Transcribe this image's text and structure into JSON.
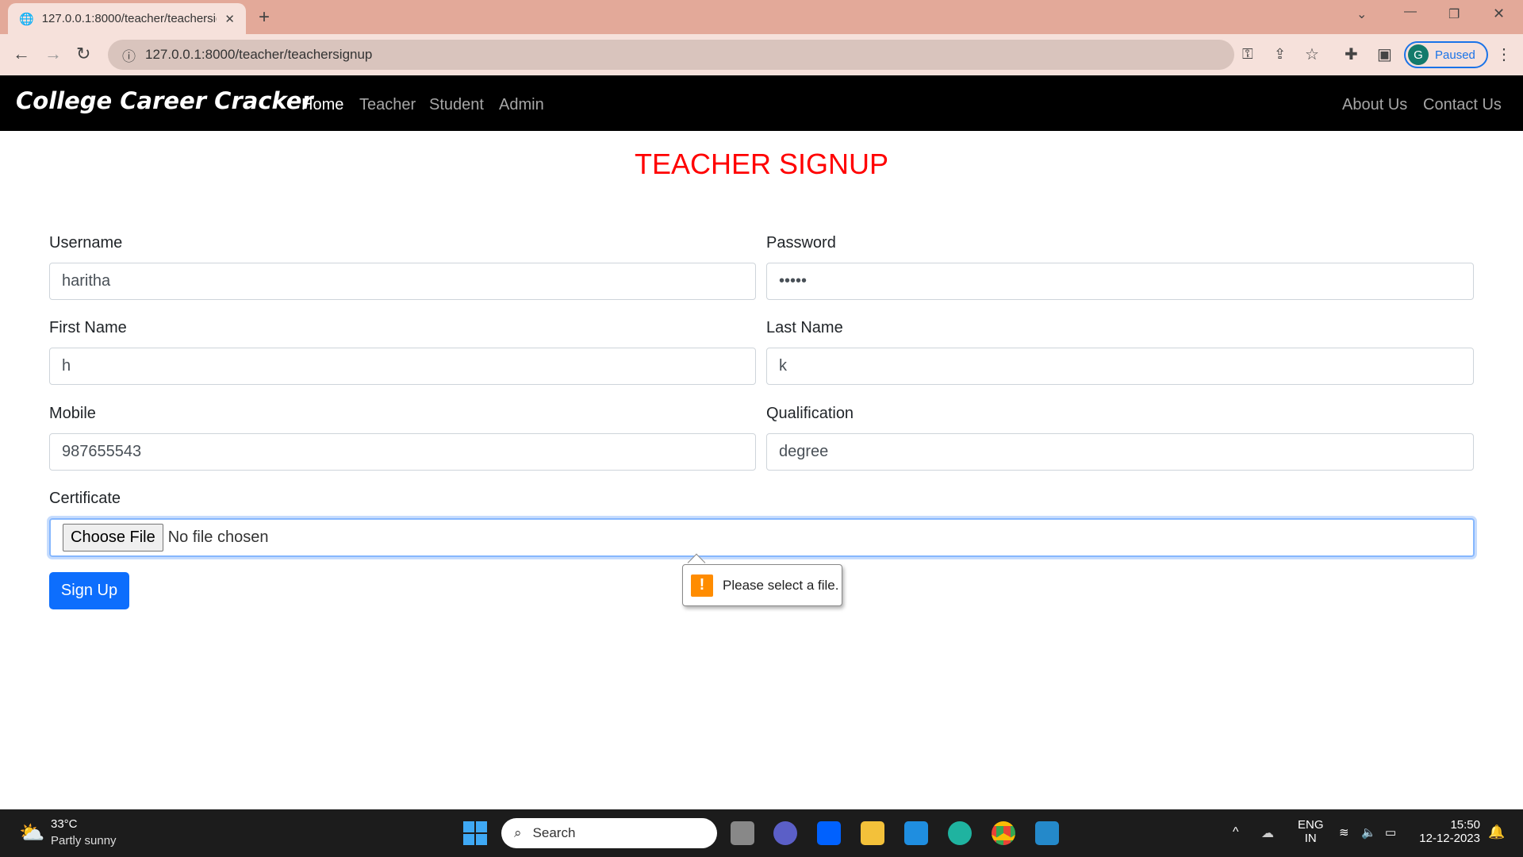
{
  "browser": {
    "tab_title": "127.0.0.1:8000/teacher/teachersignup",
    "url": "127.0.0.1:8000/teacher/teachersignup",
    "profile_initial": "G",
    "profile_status": "Paused"
  },
  "navbar": {
    "brand": "College Career Cracker",
    "links": [
      "Home",
      "Teacher",
      "Student",
      "Admin"
    ],
    "right_links": [
      "About Us",
      "Contact Us"
    ]
  },
  "page": {
    "title": "TEACHER SIGNUP"
  },
  "form": {
    "username": {
      "label": "Username",
      "value": "haritha"
    },
    "password": {
      "label": "Password",
      "value": "•••••"
    },
    "first_name": {
      "label": "First Name",
      "value": "h"
    },
    "last_name": {
      "label": "Last Name",
      "value": "k"
    },
    "mobile": {
      "label": "Mobile",
      "value": "987655543"
    },
    "qualification": {
      "label": "Qualification",
      "value": "degree"
    },
    "certificate": {
      "label": "Certificate",
      "button": "Choose File",
      "status": "No file chosen"
    },
    "submit": "Sign Up",
    "validation": "Please select a file."
  },
  "taskbar": {
    "temp": "33°C",
    "weather": "Partly sunny",
    "search": "Search",
    "lang1": "ENG",
    "lang2": "IN",
    "time": "15:50",
    "date": "12-12-2023"
  }
}
